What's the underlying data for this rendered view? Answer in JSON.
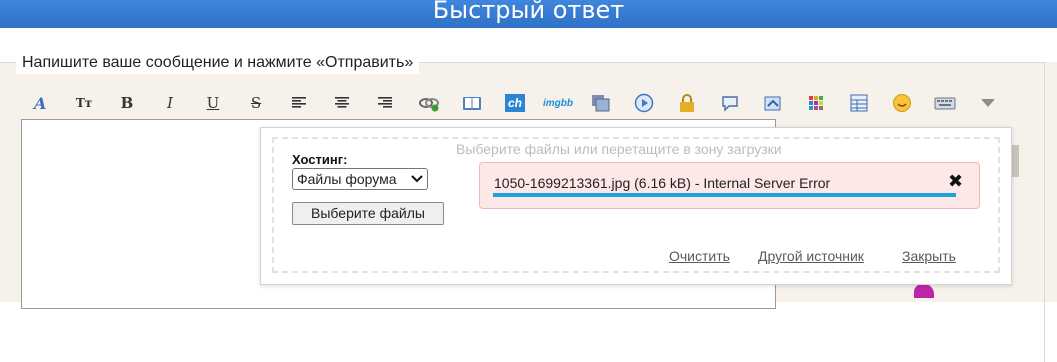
{
  "header": {
    "title": "Быстрый ответ"
  },
  "form": {
    "legend": "Напишите ваше сообщение и нажмите «Отправить»"
  },
  "toolbar": {
    "icons": [
      "font-face",
      "font-size",
      "bold",
      "italic",
      "underline",
      "strikethrough",
      "align-left",
      "align-center",
      "align-right",
      "link",
      "quote",
      "ch",
      "imgbb",
      "gallery",
      "play",
      "lock",
      "comment",
      "image-upload",
      "color-grid",
      "table",
      "smiley",
      "keyboard",
      "more-arrow"
    ],
    "labels": {
      "size": "Tт",
      "bold": "B",
      "italic": "I",
      "underline": "U",
      "strike": "S",
      "ch": "ch",
      "imgbb": "imgbb"
    }
  },
  "upload": {
    "drop_hint": "Выберите файлы или перетащите в зону загрузки",
    "hosting_label": "Хостинг:",
    "hosting_selected": "Файлы форума",
    "choose_button": "Выберите файлы",
    "file_status": "1050-1699213361.jpg (6.16 kB) - Internal Server Error",
    "file_close": "✖",
    "progress_percent": 100,
    "links": {
      "clear": "Очистить",
      "other_source": "Другой источник",
      "close": "Закрыть"
    }
  },
  "colors": {
    "header": "#3f86dc",
    "error_bg": "#fde8e8",
    "error_border": "#f1b5b5",
    "progress": "#1fa2dc"
  }
}
